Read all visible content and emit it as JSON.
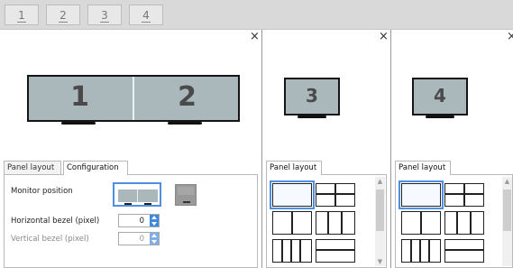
{
  "monitor_tabs": [
    "1",
    "2",
    "3",
    "4"
  ],
  "panels": {
    "main": {
      "close_glyph": "×",
      "monitors": [
        "1",
        "2"
      ],
      "tabs": [
        "Panel layout",
        "Configuration"
      ],
      "monitor_position_label": "Monitor position",
      "horizontal_bezel_label": "Horizontal bezel (pixel)",
      "horizontal_bezel_value": "0",
      "vertical_bezel_label": "Vertical bezel (pixel)",
      "vertical_bezel_value": "0"
    },
    "p3": {
      "close_glyph": "×",
      "monitor": "3",
      "tab": "Panel layout"
    },
    "p4": {
      "close_glyph": "×",
      "monitor": "4",
      "tab": "Panel layout"
    }
  },
  "colors": {
    "accent": "#4f8fe0",
    "screen": "#aab8bb",
    "spin_button": "#3e89e0"
  },
  "icons": {
    "close": "close-icon",
    "spin_up": "chevron-up-icon",
    "spin_down": "chevron-down-icon",
    "scroll_up": "chevron-up-icon",
    "scroll_down": "chevron-down-icon",
    "layouts": [
      "single-layout-icon",
      "grid-2x2-layout-icon",
      "two-columns-layout-icon",
      "three-columns-layout-icon",
      "four-columns-layout-icon",
      "two-rows-layout-icon"
    ]
  }
}
